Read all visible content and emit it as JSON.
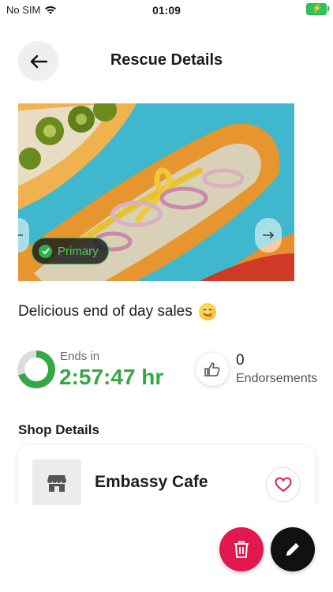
{
  "status_bar": {
    "carrier": "No SIM",
    "time": "01:09"
  },
  "header": {
    "title": "Rescue Details"
  },
  "photo": {
    "badge": "Primary"
  },
  "description": "Delicious end of day sales",
  "timer": {
    "label": "Ends in",
    "value": "2:57:47 hr",
    "progress": 0.7
  },
  "endorsements": {
    "count": "0",
    "label": "Endorsements"
  },
  "shop": {
    "section_title": "Shop Details",
    "name": "Embassy Cafe"
  },
  "colors": {
    "accent_green": "#35a845",
    "delete_red": "#e2194f",
    "heart_red": "#d8224f"
  }
}
